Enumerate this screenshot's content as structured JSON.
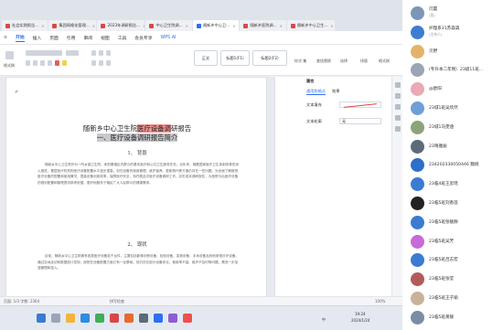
{
  "wps": {
    "doc_tabs": [
      {
        "label": "社会实践报告...",
        "kind": "pdf",
        "active": false
      },
      {
        "label": "集团网格化管理...",
        "kind": "pdf",
        "active": false
      },
      {
        "label": "2023年调研报告...",
        "kind": "pdf",
        "active": false
      },
      {
        "label": "中心卫生院调...",
        "kind": "pdf",
        "active": false
      },
      {
        "label": "随新乡中心卫...",
        "kind": "word",
        "active": true
      },
      {
        "label": "随新乡医院调...",
        "kind": "pdf",
        "active": false
      },
      {
        "label": "随新乡中心卫生...",
        "kind": "pdf",
        "active": false
      }
    ],
    "ribbon_tabs": [
      "开始",
      "插入",
      "页面",
      "引用",
      "审阅",
      "视图",
      "工具",
      "会员专享",
      "WPS AI"
    ],
    "selected_ribbon_tab": "开始",
    "ribbon": {
      "style_gallery": [
        "正文",
        "标题1(F1)",
        "标题2(F2)"
      ],
      "right_groups": [
        "样式·集",
        "查找替换",
        "选择",
        "排版",
        "格式刷"
      ],
      "left_group_label": "格式刷"
    },
    "document": {
      "title_prefix": "随新乡中心卫生院",
      "title_highlight": "医疗设备调",
      "title_suffix": "研报告",
      "subtitle": "一、医疗设备调研报告简介",
      "sections": [
        {
          "heading": "1、 背景",
          "text": "随新乡中心卫生院作为一所乡镇卫生院，承担着辖区内群众的基本医疗和公共卫生服务任务。近年来，随着国家医疗卫生体制改革的深入推进，基层医疗机构的医疗设备配置水平逐步提高，但在设备的使用管理、维护保养、更新换代等方面仍存在一些问题。为全面了解医院医疗设备的配置和使用情况，提高设备利用效率，保障医疗安全，特开展此次医疗设备调研工作，并形成本调研报告，为医院今后医疗设备的规划配置和管理提供参考依据，更好地服务于辖区广大人民群众的健康需求。"
        },
        {
          "heading": "2、 现状",
          "text": "目前，随新乡中心卫生院拥有各类医疗设备若干台件，主要包括影像诊断设备、检验设备、急救设备、手术设备及其他常规诊疗设备。通过实地走访和数据统计发现，医院在设备配置方面已有一定基础，但仍存在部分设备老化、使用率不高、维护不及时等问题，需进一步加强管理和投入。"
        }
      ]
    },
    "pane": {
      "title": "属性",
      "tabs": [
        "通用和格式",
        "效果"
      ],
      "rows": [
        "文本填充",
        "文本轮廓"
      ],
      "fill_value": "",
      "outline_value": "无"
    },
    "status": {
      "left": "页面: 1/3  字数: 2364",
      "middle": "拼写检查",
      "right": "100%"
    },
    "tray": {
      "time": "19:24",
      "date": "2024/1/24",
      "lang": "中"
    }
  },
  "people": [
    {
      "name": "闫蕾",
      "sub": "(我)",
      "avatar_color": "#7c96b8"
    },
    {
      "name": "护理系31苏森森",
      "sub": "(主持人)",
      "avatar_color": "#3f7dd1"
    },
    {
      "name": "贝野",
      "sub": "",
      "avatar_color": "#e3b36b"
    },
    {
      "name": "(专升本二年制）23级11班...",
      "sub": "",
      "avatar_color": "#9aa6b6"
    },
    {
      "name": "@欧阳",
      "sub": "",
      "avatar_color": "#e9a9b5"
    },
    {
      "name": "23城1班吴欣然",
      "sub": "",
      "avatar_color": "#6f9fd8"
    },
    {
      "name": "23城1马雯涵",
      "sub": "",
      "avatar_color": "#8da37a"
    },
    {
      "name": "23晴雅骊",
      "sub": "",
      "avatar_color": "#5b6b78"
    },
    {
      "name": "234202330050446 魏婉",
      "sub": "",
      "avatar_color": "#2e6fc9"
    },
    {
      "name": "23临4班王思瑶",
      "sub": "",
      "avatar_color": "#3b7bd1"
    },
    {
      "name": "23临5班刘香莲",
      "sub": "",
      "avatar_color": "#222222"
    },
    {
      "name": "23临5班张靓静",
      "sub": "",
      "avatar_color": "#3b7bd1"
    },
    {
      "name": "23临5班吴芳",
      "sub": "",
      "avatar_color": "#c86ad8"
    },
    {
      "name": "23临5班吕志宏",
      "sub": "",
      "avatar_color": "#3b7bd1"
    },
    {
      "name": "23临5班张莹",
      "sub": "",
      "avatar_color": "#b55a5a"
    },
    {
      "name": "23临5班王子瑜",
      "sub": "",
      "avatar_color": "#c9b29a"
    },
    {
      "name": "23临5班黄靓",
      "sub": "",
      "avatar_color": "#7a8ea3"
    }
  ]
}
